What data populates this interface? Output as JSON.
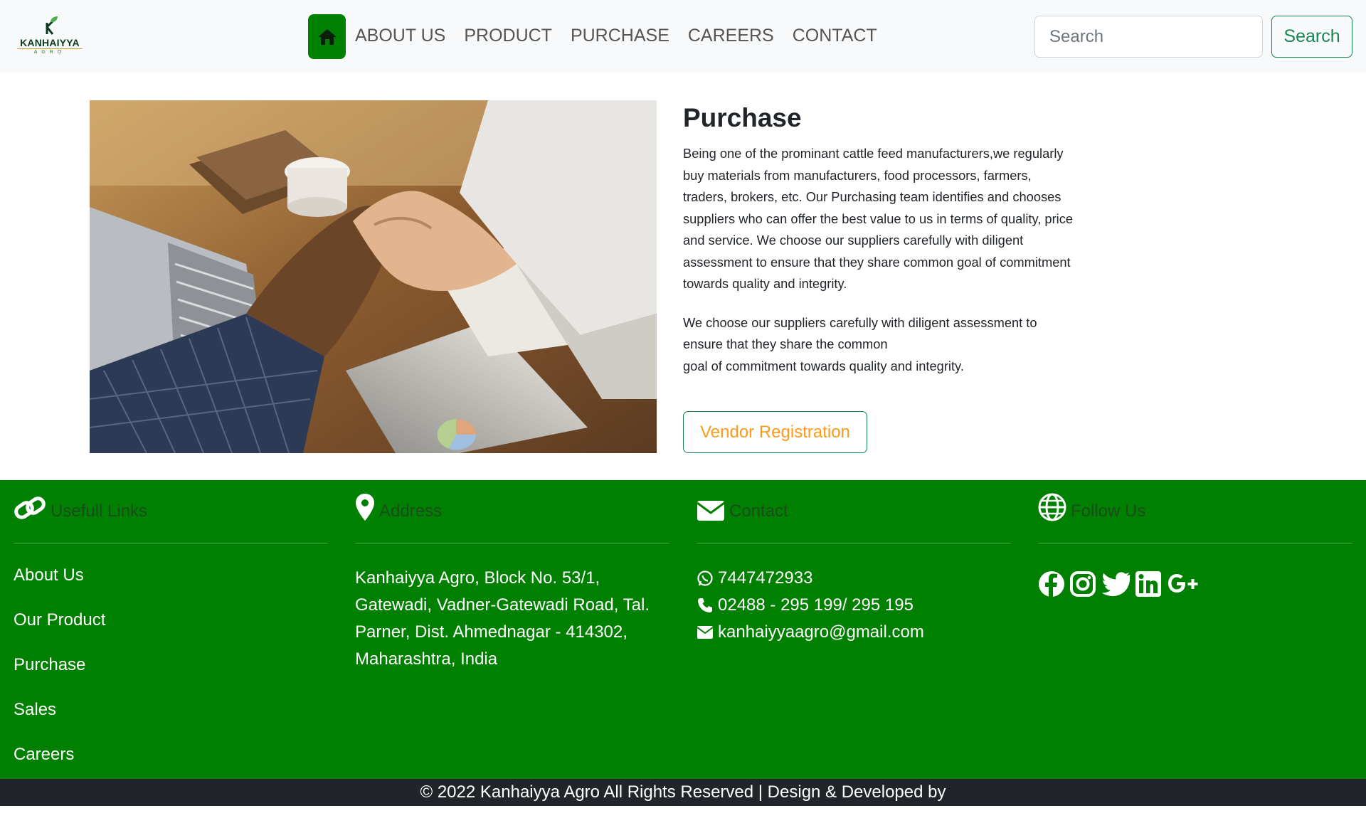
{
  "brand": {
    "name": "KANHAIYYA",
    "sub": "AGRO"
  },
  "nav": {
    "home_icon": "home-icon",
    "links": [
      "ABOUT US",
      "PRODUCT",
      "PURCHASE",
      "CAREERS",
      "CONTACT"
    ]
  },
  "search": {
    "placeholder": "Search",
    "button": "Search"
  },
  "main": {
    "image_alt": "handshake-photo",
    "title": "Purchase",
    "para1": "Being one of the prominant cattle feed manufacturers,we regularly buy materials from manufacturers, food processors, farmers, traders, brokers, etc. Our Purchasing team identifies and chooses suppliers who can offer the best value to us in terms of quality, price and service. We choose our suppliers carefully with diligent assessment to ensure that they share common goal of commitment towards quality and integrity.",
    "para2_line1": "We choose our suppliers carefully with diligent assessment to ensure that they share the common",
    "para2_line2": "goal of commitment towards quality and integrity.",
    "vendor_button": "Vendor Registration"
  },
  "footer": {
    "links_title": "Usefull Links",
    "links": [
      "About Us",
      "Our Product",
      "Purchase",
      "Sales",
      "Careers"
    ],
    "address_title": "Address",
    "address": "Kanhaiyya Agro, Block No. 53/1, Gatewadi, Vadner-Gatewadi Road, Tal. Parner, Dist. Ahmednagar - 414302, Maharashtra, India",
    "contact_title": "Contact",
    "whatsapp": "7447472933",
    "phone": "02488 - 295 199/ 295 195",
    "email": "kanhaiyyaagro@gmail.com",
    "follow_title": "Follow Us",
    "social": [
      "facebook-icon",
      "instagram-icon",
      "twitter-icon",
      "linkedin-icon",
      "google-plus-icon"
    ]
  },
  "copyright": "© 2022 Kanhaiyya Agro All Rights Reserved | Design & Developed by",
  "colors": {
    "primary_green": "#008000",
    "outline_green": "#198754",
    "accent_orange": "#fd9a1c",
    "dark_bar": "#212529",
    "nav_bg": "#f8f9fa"
  }
}
